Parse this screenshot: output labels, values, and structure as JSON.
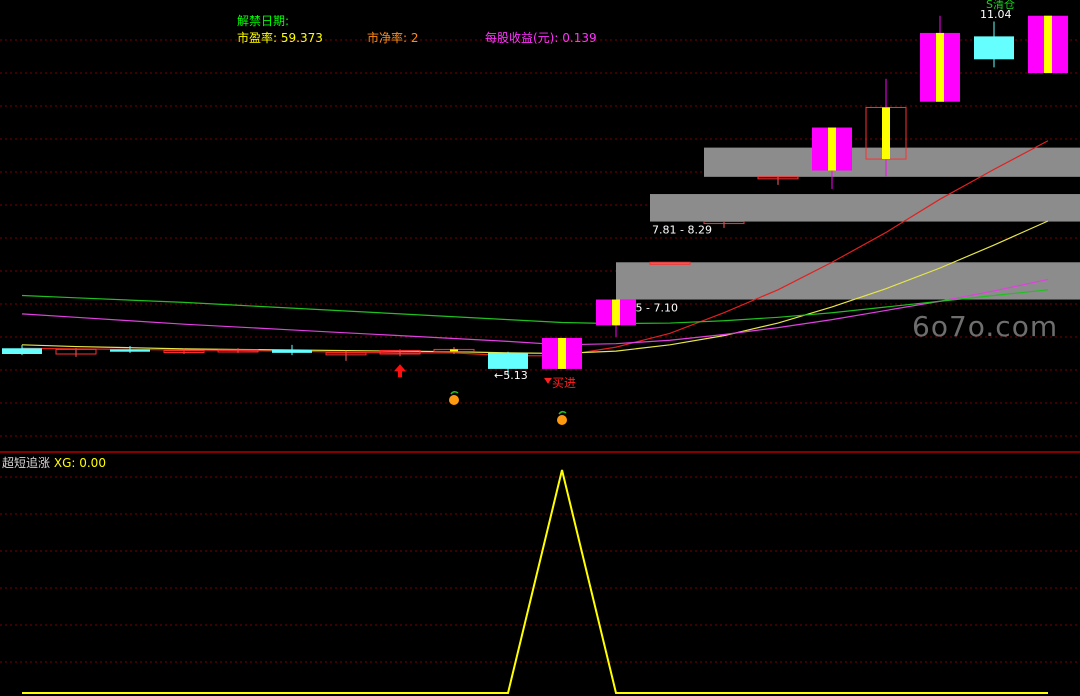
{
  "header": {
    "unlock_label": "解禁日期:",
    "pe_label": "市盈率:",
    "pe_value": "59.373",
    "pb_label": "市净率:",
    "pb_value": "2",
    "eps_label": "每股收益(元):",
    "eps_value": "0.139"
  },
  "sub_header": {
    "indicator_name": "超短追涨",
    "xg_label": "XG:",
    "xg_value": "0.00"
  },
  "watermark": "6o7o.com",
  "colors": {
    "background": "#000000",
    "grid": "#7a0000",
    "up_candle": "#ff00ff",
    "up_body_inner": "#ffff00",
    "down_candle": "#66ffff",
    "ma_red": "#e02020",
    "ma_yellow": "#e6e64a",
    "ma_magenta": "#e040e0",
    "ma_green": "#20c020",
    "zone_fill": "#8c8c8c",
    "signal_line": "#ffff00"
  },
  "chart_data": [
    {
      "type": "candlestick",
      "y_range": [
        4.0,
        11.5
      ],
      "candles": [
        {
          "open": 5.6,
          "high": 5.66,
          "low": 5.48,
          "close": 5.5,
          "dir": "down"
        },
        {
          "open": 5.5,
          "high": 5.6,
          "low": 5.45,
          "close": 5.58,
          "dir": "flat"
        },
        {
          "open": 5.58,
          "high": 5.64,
          "low": 5.52,
          "close": 5.54,
          "dir": "down"
        },
        {
          "open": 5.54,
          "high": 5.6,
          "low": 5.5,
          "close": 5.56,
          "dir": "flat"
        },
        {
          "open": 5.56,
          "high": 5.6,
          "low": 5.52,
          "close": 5.57,
          "dir": "flat"
        },
        {
          "open": 5.57,
          "high": 5.66,
          "low": 5.48,
          "close": 5.52,
          "dir": "down"
        },
        {
          "open": 5.52,
          "high": 5.56,
          "low": 5.38,
          "close": 5.5,
          "dir": "flat"
        },
        {
          "open": 5.5,
          "high": 5.58,
          "low": 5.46,
          "close": 5.56,
          "dir": "flat"
        },
        {
          "open": 5.56,
          "high": 5.62,
          "low": 5.5,
          "close": 5.58,
          "dir": "up_small"
        },
        {
          "open": 5.52,
          "high": 5.54,
          "low": 5.13,
          "close": 5.24,
          "dir": "down"
        },
        {
          "open": 5.24,
          "high": 5.78,
          "low": 5.24,
          "close": 5.78,
          "dir": "up"
        },
        {
          "open": 6.0,
          "high": 6.45,
          "low": 5.8,
          "close": 6.45,
          "dir": "up"
        },
        {
          "open": 7.1,
          "high": 7.1,
          "low": 7.1,
          "close": 7.1,
          "dir": "flat"
        },
        {
          "open": 7.81,
          "high": 7.81,
          "low": 7.7,
          "close": 7.81,
          "dir": "flat"
        },
        {
          "open": 8.59,
          "high": 8.59,
          "low": 8.45,
          "close": 8.59,
          "dir": "flat"
        },
        {
          "open": 8.7,
          "high": 9.45,
          "low": 8.38,
          "close": 9.45,
          "dir": "up"
        },
        {
          "open": 8.9,
          "high": 10.3,
          "low": 8.6,
          "close": 9.8,
          "dir": "up_hollow"
        },
        {
          "open": 9.9,
          "high": 11.4,
          "low": 9.9,
          "close": 11.1,
          "dir": "up"
        },
        {
          "open": 11.04,
          "high": 11.3,
          "low": 10.5,
          "close": 10.64,
          "dir": "down"
        },
        {
          "open": 10.4,
          "high": 11.4,
          "low": 10.4,
          "close": 11.4,
          "dir": "up"
        }
      ],
      "ma_series": [
        {
          "color_key": "ma_red",
          "values": [
            5.6,
            5.59,
            5.58,
            5.57,
            5.56,
            5.55,
            5.53,
            5.52,
            5.52,
            5.47,
            5.47,
            5.62,
            5.86,
            6.22,
            6.62,
            7.1,
            7.62,
            8.2,
            8.72,
            9.22
          ]
        },
        {
          "color_key": "ma_yellow",
          "values": [
            5.66,
            5.63,
            5.61,
            5.59,
            5.58,
            5.57,
            5.56,
            5.55,
            5.54,
            5.52,
            5.51,
            5.55,
            5.66,
            5.82,
            6.04,
            6.32,
            6.64,
            7.0,
            7.4,
            7.82
          ]
        },
        {
          "color_key": "ma_magenta",
          "values": [
            6.2,
            6.14,
            6.08,
            6.02,
            5.97,
            5.92,
            5.87,
            5.82,
            5.77,
            5.72,
            5.66,
            5.68,
            5.74,
            5.84,
            5.96,
            6.1,
            6.26,
            6.42,
            6.6,
            6.8
          ]
        },
        {
          "color_key": "ma_green",
          "values": [
            6.52,
            6.48,
            6.44,
            6.4,
            6.35,
            6.3,
            6.25,
            6.2,
            6.15,
            6.1,
            6.05,
            6.03,
            6.04,
            6.08,
            6.14,
            6.22,
            6.32,
            6.42,
            6.52,
            6.62
          ]
        }
      ],
      "zones": [
        {
          "label": "6.45 - 7.10",
          "from": 6.45,
          "to": 7.1,
          "start_index": 11
        },
        {
          "label": "7.81 - 8.29",
          "from": 7.81,
          "to": 8.29,
          "start_index": 12
        },
        {
          "label": "",
          "from": 8.59,
          "to": 9.1,
          "start_index": 13
        }
      ],
      "annotations": [
        {
          "text": "←5.13",
          "index": 9,
          "value": 5.13
        },
        {
          "text": "买进",
          "index": 10,
          "value": 5.24
        },
        {
          "text": "11.04",
          "index": 18,
          "value": 11.04
        },
        {
          "text": "S清仓",
          "index": 18,
          "value": 11.3
        }
      ],
      "markers": [
        {
          "kind": "up-arrow",
          "index": 7
        },
        {
          "kind": "orange",
          "index": 8
        },
        {
          "kind": "orange",
          "index": 10
        }
      ]
    },
    {
      "type": "line",
      "name": "XG",
      "y_range": [
        0,
        1
      ],
      "values": [
        0,
        0,
        0,
        0,
        0,
        0,
        0,
        0,
        0,
        0,
        1,
        0,
        0,
        0,
        0,
        0,
        0,
        0,
        0,
        0
      ]
    }
  ]
}
